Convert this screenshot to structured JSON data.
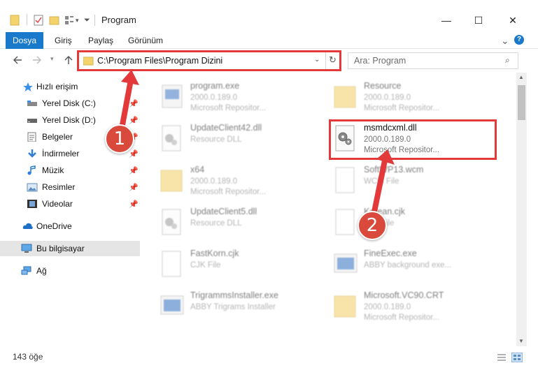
{
  "window": {
    "title": "Program",
    "minimize_glyph": "—",
    "maximize_glyph": "☐",
    "close_glyph": "✕"
  },
  "ribbon": {
    "tabs": [
      "Dosya",
      "Giriş",
      "Paylaş",
      "Görünüm"
    ],
    "expand_glyph": "⌄",
    "help_glyph": "?"
  },
  "address": {
    "path": "C:\\Program Files\\Program Dizini",
    "search_placeholder": "Ara: Program"
  },
  "sidebar": {
    "items": [
      {
        "label": "Hızlı erişim",
        "icon": "star-icon"
      },
      {
        "label": "Yerel Disk (C:)",
        "icon": "drive-icon",
        "pinned": true
      },
      {
        "label": "Yerel Disk (D:)",
        "icon": "drive-icon",
        "pinned": true
      },
      {
        "label": "Belgeler",
        "icon": "documents-icon",
        "pinned": true
      },
      {
        "label": "İndirmeler",
        "icon": "download-icon",
        "pinned": true
      },
      {
        "label": "Müzik",
        "icon": "music-icon",
        "pinned": true
      },
      {
        "label": "Resimler",
        "icon": "pictures-icon",
        "pinned": true
      },
      {
        "label": "Videolar",
        "icon": "video-icon",
        "pinned": true
      },
      {
        "label": "OneDrive",
        "icon": "cloud-icon"
      },
      {
        "label": "Bu bilgisayar",
        "icon": "computer-icon",
        "selected": true
      },
      {
        "label": "Ağ",
        "icon": "network-icon"
      }
    ]
  },
  "files": [
    {
      "name": "program.exe",
      "line1": "2000.0.189.0",
      "line2": "Microsoft Repositor...",
      "icon": "exe-icon"
    },
    {
      "name": "Resource",
      "line1": "2000.0.189.0",
      "line2": "Microsoft Repositor...",
      "icon": "folder-icon"
    },
    {
      "name": "UpdateClient42.dll",
      "line1": "Resource DLL",
      "line2": "",
      "icon": "dll-icon"
    },
    {
      "name": "msmdcxml.dll",
      "line1": "2000.0.189.0",
      "line2": "Microsoft Repositor...",
      "icon": "dll-icon"
    },
    {
      "name": "x64",
      "line1": "2000.0.189.0",
      "line2": "Microsoft Repositor...",
      "icon": "folder-icon"
    },
    {
      "name": "SoftWP13.wcm",
      "line1": "WCM File",
      "line2": "",
      "icon": "file-icon"
    },
    {
      "name": "UpdateClient5.dll",
      "line1": "Resource DLL",
      "line2": "",
      "icon": "dll-icon"
    },
    {
      "name": "Korean.cjk",
      "line1": "CJK File",
      "line2": "",
      "icon": "file-icon"
    },
    {
      "name": "FastKorn.cjk",
      "line1": "CJK File",
      "line2": "",
      "icon": "file-icon"
    },
    {
      "name": "FineExec.exe",
      "line1": "ABBY background exe...",
      "line2": "",
      "icon": "exe-icon"
    },
    {
      "name": "TrigrammsInstaller.exe",
      "line1": "ABBY Trigrams Installer",
      "line2": "",
      "icon": "exe-icon"
    },
    {
      "name": "Microsoft.VC90.CRT",
      "line1": "2000.0.189.0",
      "line2": "Microsoft Repositor...",
      "icon": "folder-icon"
    }
  ],
  "status": {
    "item_count": "143 öğe"
  },
  "annotations": {
    "badge1": "1",
    "badge2": "2"
  },
  "colors": {
    "accent": "#1979ca",
    "highlight_red": "#e3393b",
    "badge_red": "#d94a3c"
  }
}
